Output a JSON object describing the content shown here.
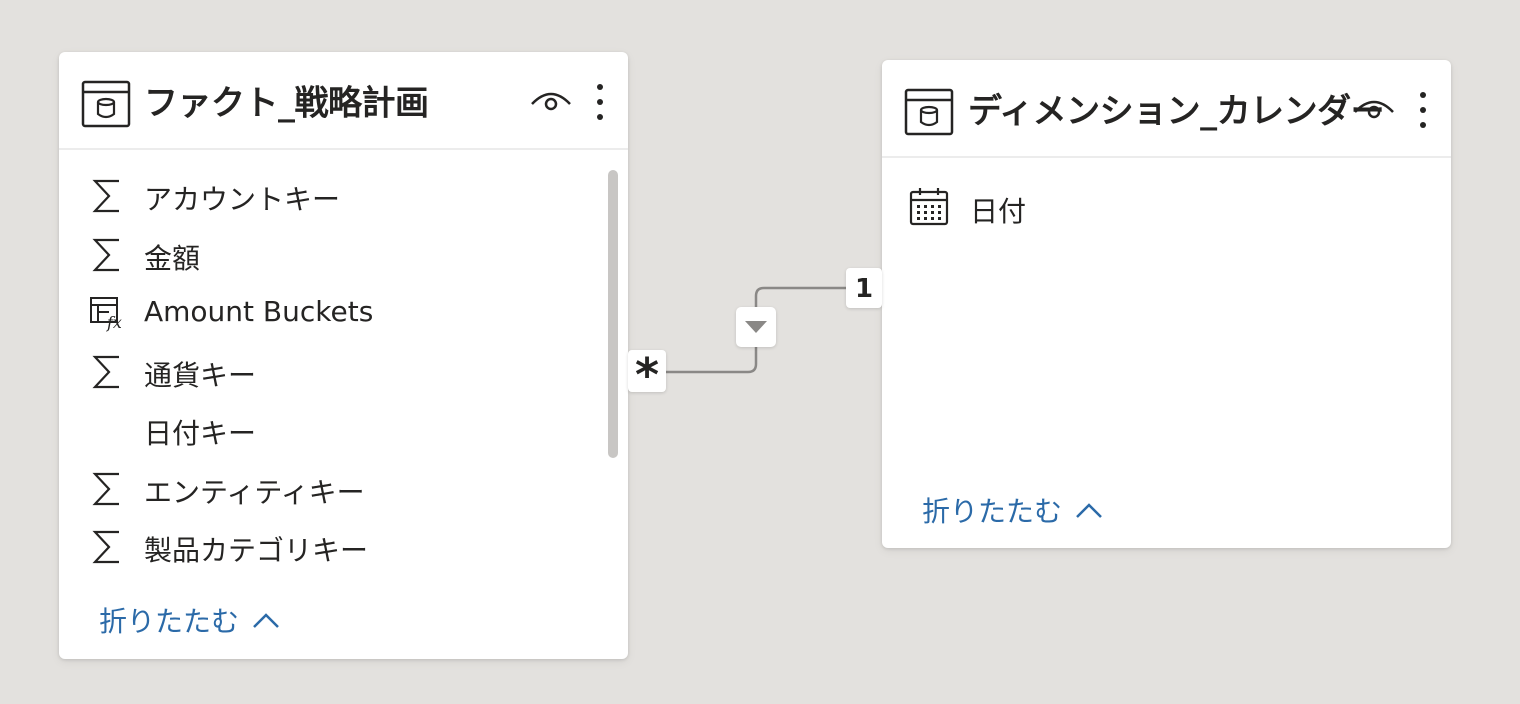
{
  "fact_table": {
    "title": "ファクト_戦略計画",
    "fields": [
      {
        "icon": "sigma-icon",
        "label": "アカウントキー"
      },
      {
        "icon": "sigma-icon",
        "label": "金額"
      },
      {
        "icon": "calculated-column-icon",
        "label": "Amount Buckets"
      },
      {
        "icon": "sigma-icon",
        "label": "通貨キー"
      },
      {
        "icon": "",
        "label": "日付キー"
      },
      {
        "icon": "sigma-icon",
        "label": "エンティティキー"
      },
      {
        "icon": "sigma-icon",
        "label": "製品カテゴリキー"
      }
    ],
    "collapse_label": "折りたたむ"
  },
  "dim_table": {
    "title": "ディメンション_カレンダー",
    "fields": [
      {
        "icon": "calendar-icon",
        "label": "日付"
      }
    ],
    "collapse_label": "折りたたむ"
  },
  "relationship": {
    "from_cardinality": "*",
    "to_cardinality": "1"
  },
  "colors": {
    "canvas": "#e3e1de",
    "link": "#2b6aa8",
    "text": "#252423"
  }
}
